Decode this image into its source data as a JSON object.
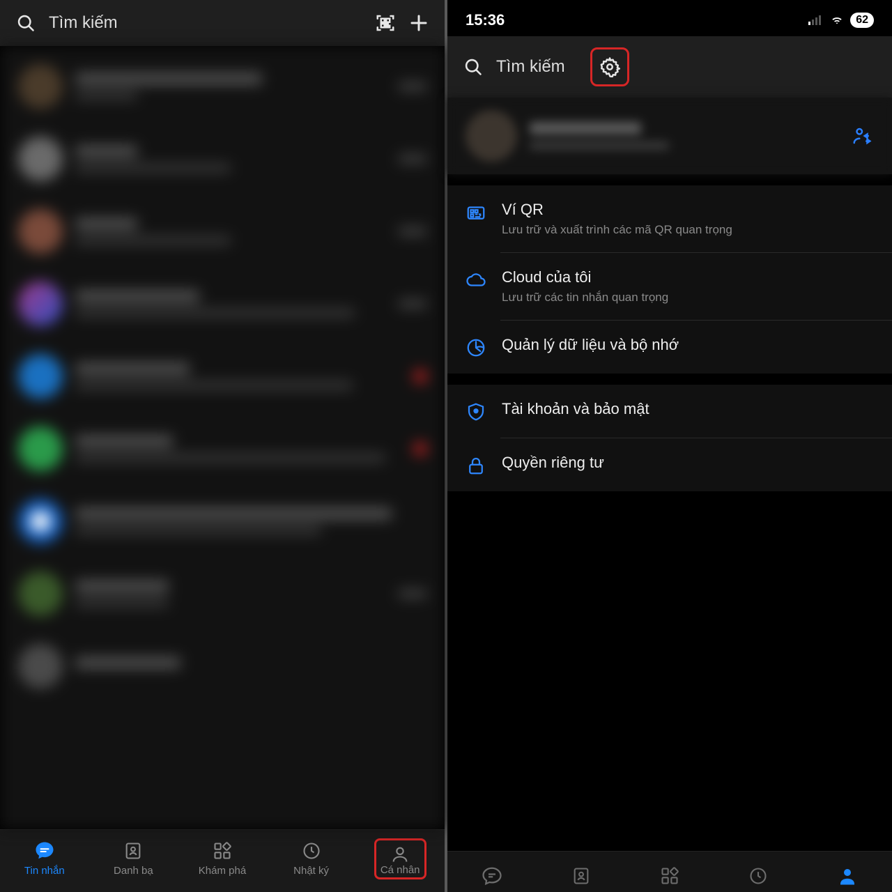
{
  "left": {
    "search_placeholder": "Tìm kiếm",
    "nav": [
      {
        "label": "Tin nhắn",
        "active": true
      },
      {
        "label": "Danh bạ",
        "active": false
      },
      {
        "label": "Khám phá",
        "active": false
      },
      {
        "label": "Nhật ký",
        "active": false
      },
      {
        "label": "Cá nhân",
        "active": false,
        "highlight": true
      }
    ]
  },
  "right": {
    "status": {
      "time": "15:36",
      "battery": "62"
    },
    "search_placeholder": "Tìm kiếm",
    "settings_groups": [
      [
        {
          "icon": "qr-wallet",
          "title": "Ví QR",
          "sub": "Lưu trữ và xuất trình các mã QR quan trọng"
        },
        {
          "icon": "cloud",
          "title": "Cloud của tôi",
          "sub": "Lưu trữ các tin nhắn quan trọng"
        },
        {
          "icon": "data",
          "title": "Quản lý dữ liệu và bộ nhớ",
          "sub": ""
        }
      ],
      [
        {
          "icon": "shield",
          "title": "Tài khoản và bảo mật",
          "sub": ""
        },
        {
          "icon": "lock",
          "title": "Quyền riêng tư",
          "sub": ""
        }
      ]
    ]
  }
}
